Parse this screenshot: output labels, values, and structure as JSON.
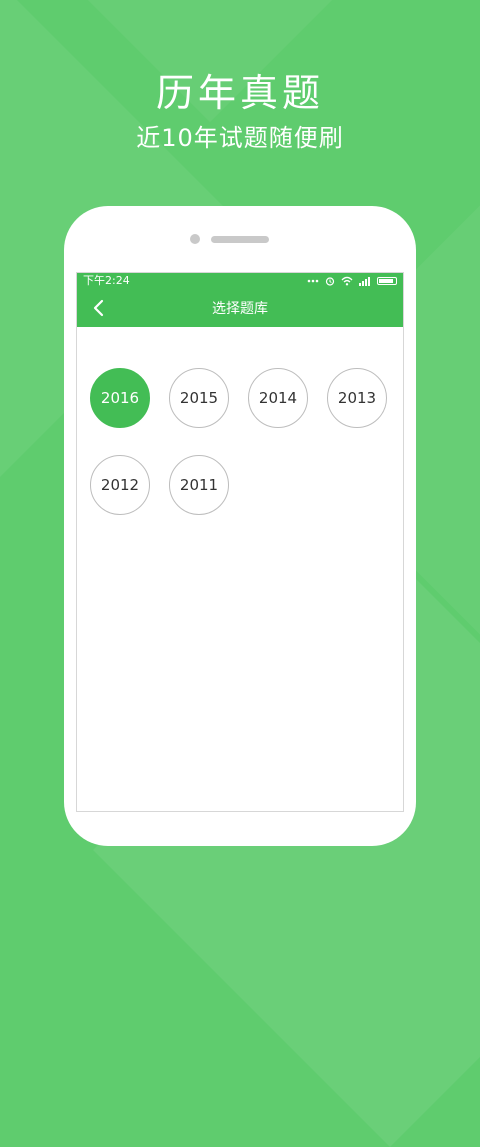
{
  "promo": {
    "title": "历年真题",
    "subtitle": "近10年试题随便刷"
  },
  "status_bar": {
    "time": "下午2:24",
    "icons": [
      "more-dots-icon",
      "alarm-icon",
      "wifi-icon",
      "signal-icon",
      "battery-icon"
    ]
  },
  "toolbar": {
    "back_icon": "chevron-left-icon",
    "title": "选择题库"
  },
  "years": {
    "selected": "2016",
    "items": [
      "2016",
      "2015",
      "2014",
      "2013",
      "2012",
      "2011"
    ]
  },
  "colors": {
    "background": "#5fcc6e",
    "accent": "#43bd55",
    "text": "#333333",
    "circle_border": "#bdbdbd"
  }
}
